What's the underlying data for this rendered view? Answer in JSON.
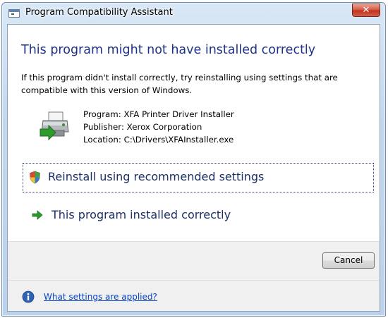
{
  "window": {
    "title": "Program Compatibility Assistant",
    "close_label": "✕"
  },
  "content": {
    "heading": "This program might not have installed correctly",
    "description": "If this program didn't install correctly, try reinstalling using settings that are compatible with this version of Windows."
  },
  "program": {
    "icon": "printer-icon",
    "name_line": "Program: XFA Printer Driver Installer",
    "publisher_line": "Publisher: Xerox Corporation",
    "location_line": "Location: C:\\Drivers\\XFAInstaller.exe"
  },
  "options": [
    {
      "label": "Reinstall using recommended settings",
      "icon": "shield-icon"
    },
    {
      "label": "This program installed correctly",
      "icon": "green-arrow-icon"
    }
  ],
  "buttons": {
    "cancel": "Cancel"
  },
  "footer": {
    "icon": "info-icon",
    "link": "What settings are applied?"
  },
  "colors": {
    "heading": "#1e3287",
    "option_text": "#1c2f66",
    "link": "#0645c8",
    "close_button": "#c12f1b",
    "arrow": "#2a9a2a"
  }
}
